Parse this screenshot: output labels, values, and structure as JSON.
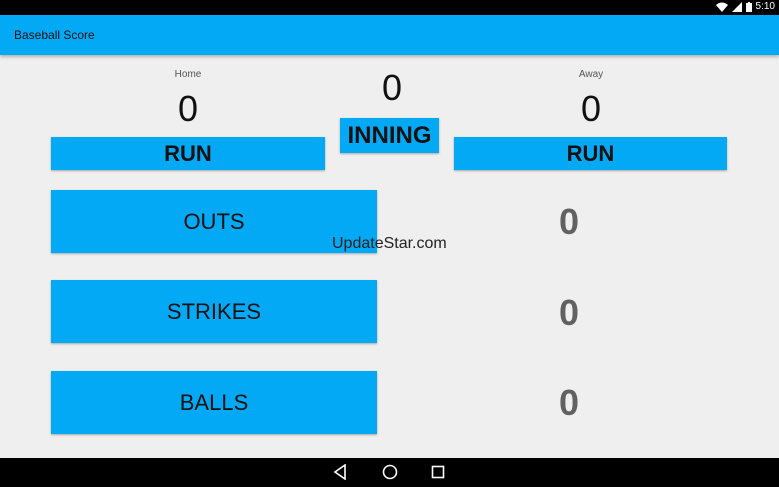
{
  "status": {
    "time": "5:10"
  },
  "app": {
    "title": "Baseball Score"
  },
  "home": {
    "label": "Home",
    "score": "0",
    "button": "RUN"
  },
  "away": {
    "label": "Away",
    "score": "0",
    "button": "RUN"
  },
  "inning": {
    "value": "0",
    "button": "INNING"
  },
  "counters": {
    "outs": {
      "button": "OUTS",
      "value": "0"
    },
    "strikes": {
      "button": "STRIKES",
      "value": "0"
    },
    "balls": {
      "button": "BALLS",
      "value": "0"
    }
  },
  "watermark": "UpdateStar.com",
  "icons": [
    "wifi-icon",
    "signal-icon",
    "battery-icon",
    "back-icon",
    "home-icon",
    "recents-icon"
  ]
}
